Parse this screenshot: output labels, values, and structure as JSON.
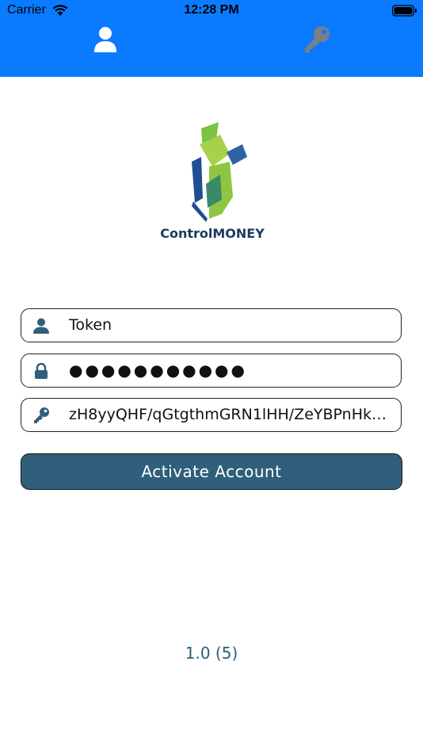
{
  "status_bar": {
    "carrier": "Carrier",
    "time": "12:28 PM"
  },
  "tabs": [
    {
      "icon": "user-icon",
      "active": true
    },
    {
      "icon": "key-icon",
      "active": false
    }
  ],
  "logo": {
    "brand_name": "ControlMONEY"
  },
  "form": {
    "token_value": "Token",
    "password_value": "●●●●●●●●●●●",
    "key_value": "zH8yyQHF/qGtgthmGRN1lHH/ZeYBPnHkrw..."
  },
  "activate_button": {
    "label": "Activate Account"
  },
  "version": "1.0 (5)",
  "colors": {
    "header": "#0a7bff",
    "button": "#2f5f7a",
    "version_text": "#2f5f7a"
  }
}
